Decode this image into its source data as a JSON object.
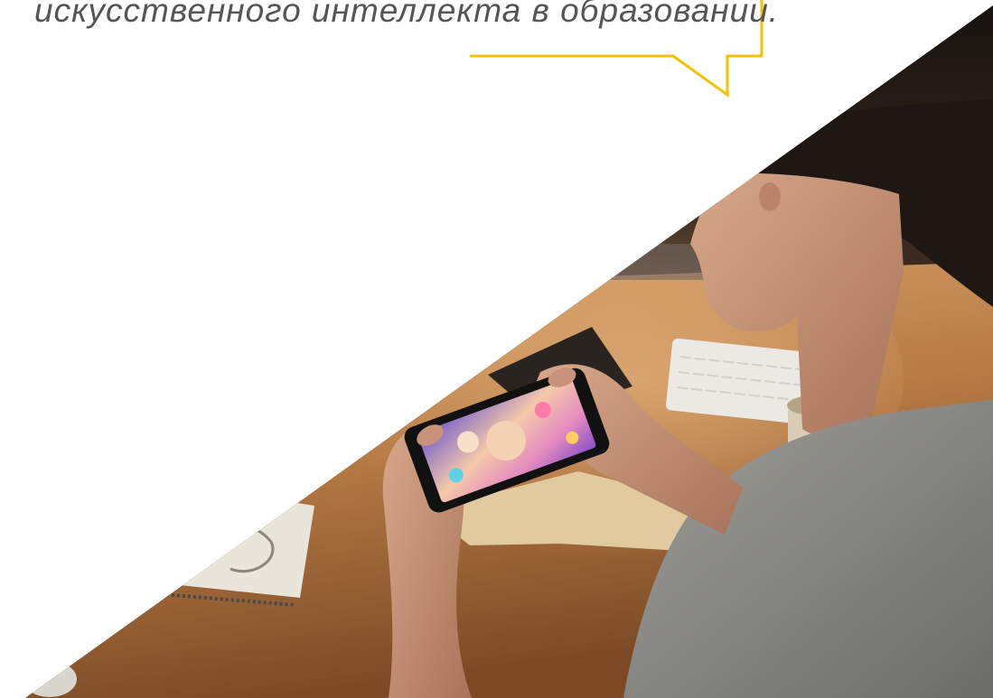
{
  "slide": {
    "quote_text": "искусственного интеллекта в образовании.",
    "text_color": "#555555",
    "accent_color": "#f2c200"
  },
  "photo": {
    "icon": "photo-person-playing-mobile-game"
  }
}
